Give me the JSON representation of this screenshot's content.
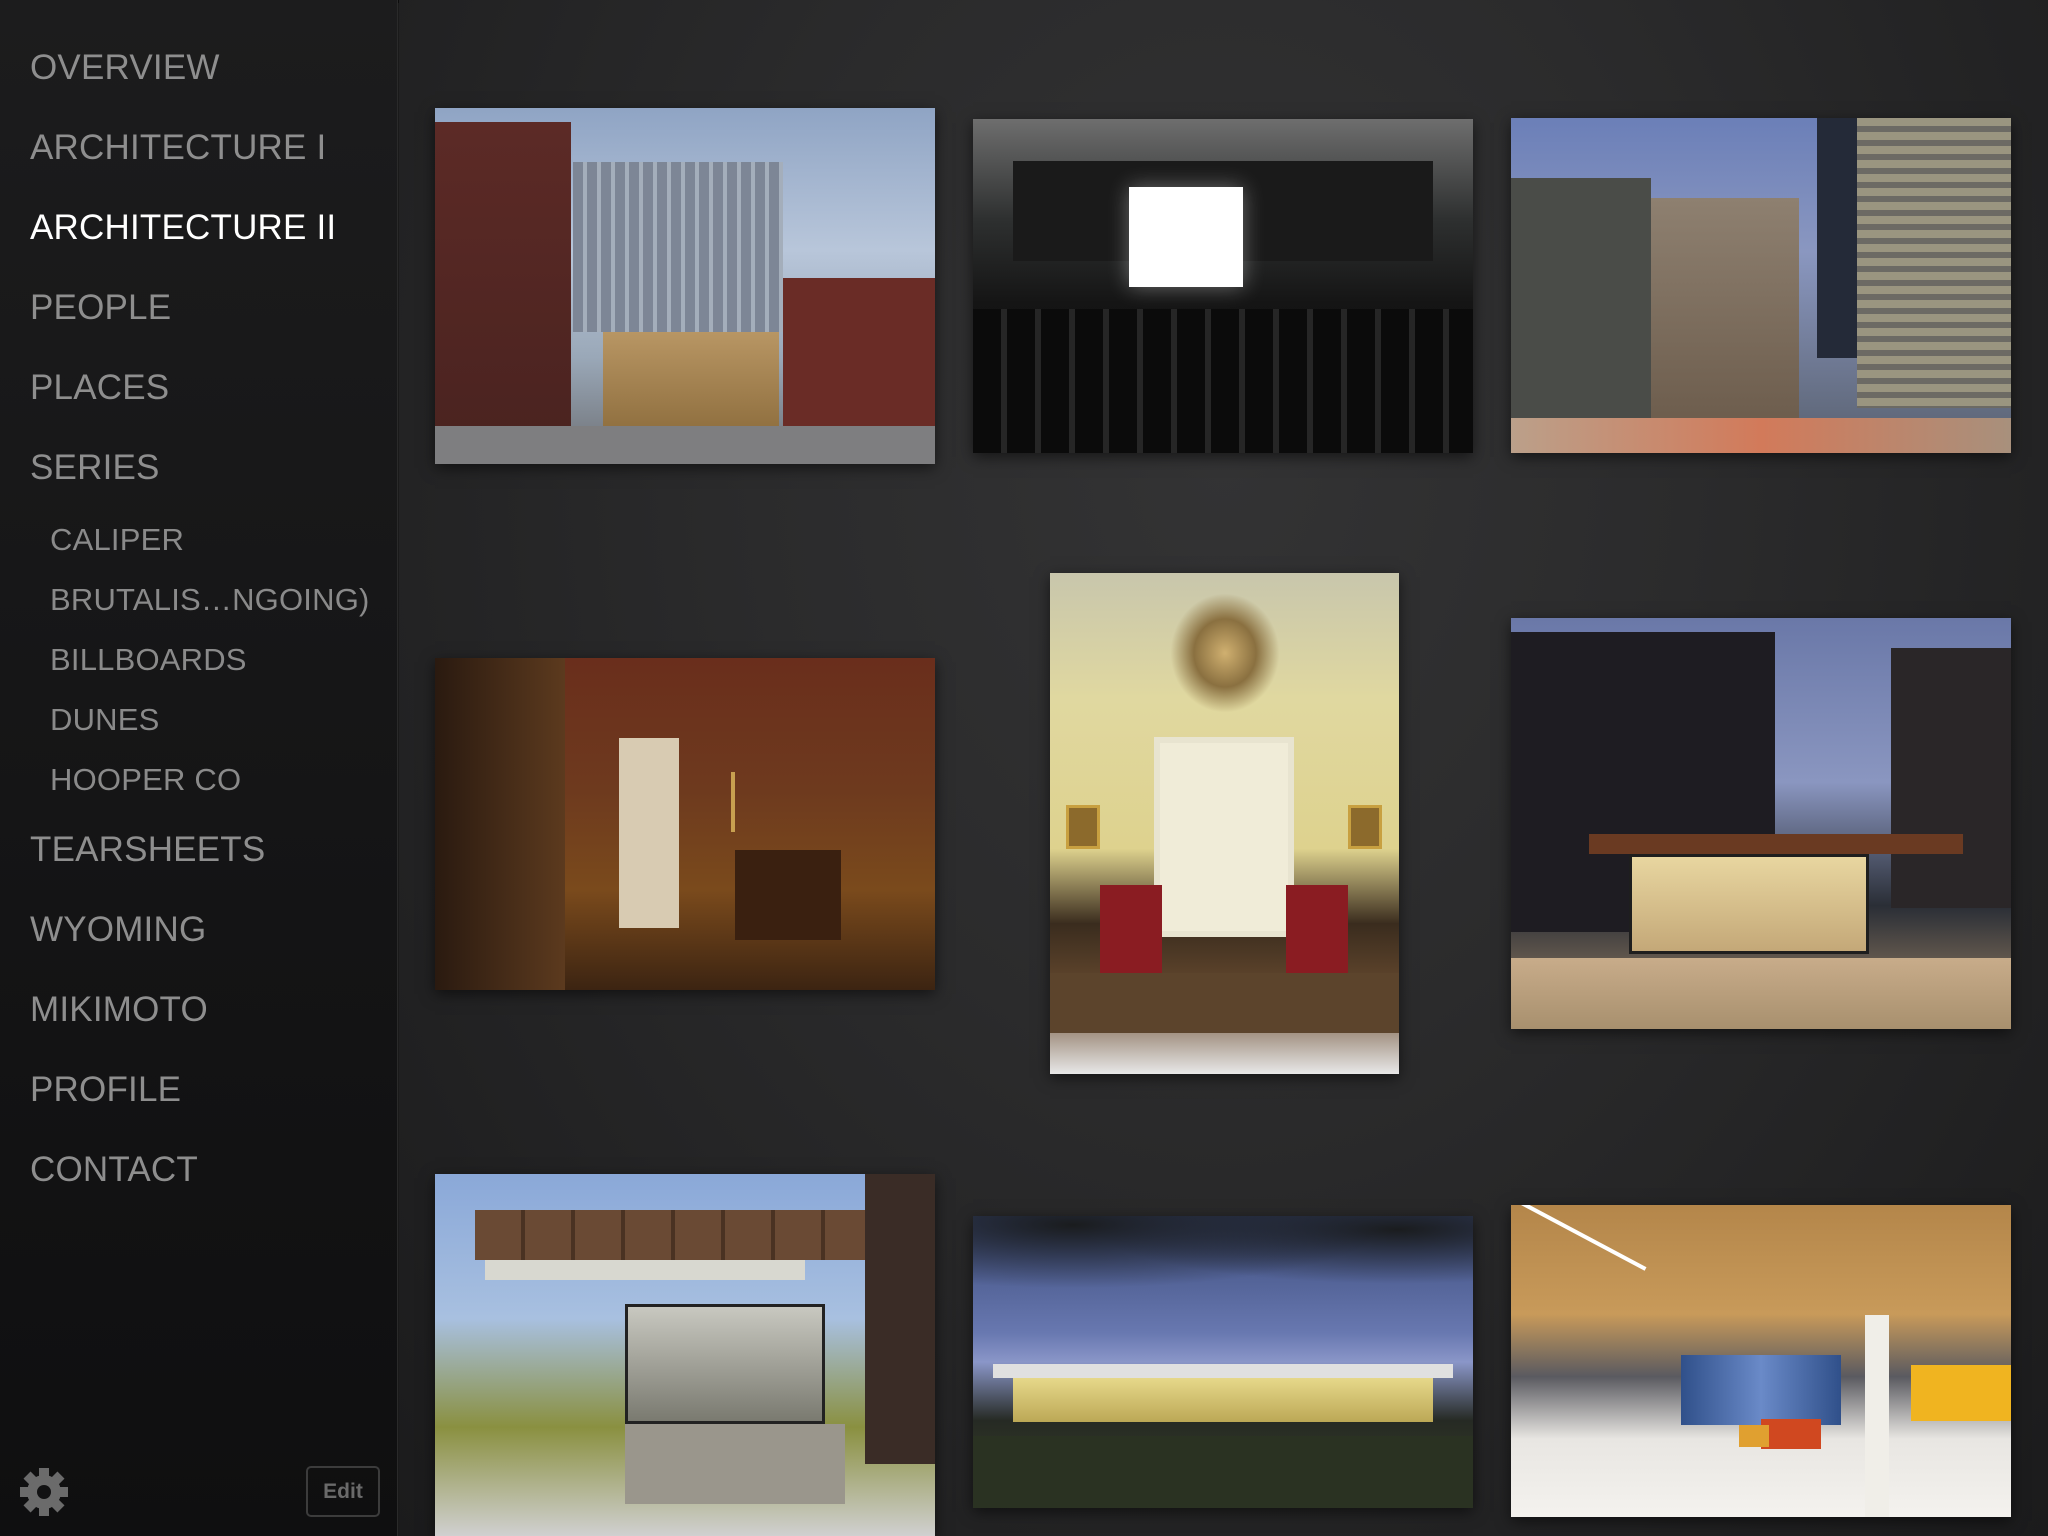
{
  "sidebar": {
    "items": [
      {
        "label": "OVERVIEW",
        "active": false
      },
      {
        "label": "ARCHITECTURE I",
        "active": false
      },
      {
        "label": "ARCHITECTURE II",
        "active": true
      },
      {
        "label": "PEOPLE",
        "active": false
      },
      {
        "label": "PLACES",
        "active": false
      },
      {
        "label": "SERIES",
        "active": false
      }
    ],
    "series_items": [
      {
        "label": "CALIPER"
      },
      {
        "label": "BRUTALIS…NGOING)"
      },
      {
        "label": "BILLBOARDS"
      },
      {
        "label": "DUNES"
      },
      {
        "label": "HOOPER CO"
      }
    ],
    "items_after": [
      {
        "label": "TEARSHEETS"
      },
      {
        "label": "WYOMING"
      },
      {
        "label": "MIKIMOTO"
      },
      {
        "label": "PROFILE"
      },
      {
        "label": "CONTACT"
      }
    ],
    "settings_icon": "gear-icon",
    "edit_label": "Edit"
  },
  "gallery": {
    "selected_section": "ARCHITECTURE II",
    "photos": [
      {
        "subject": "brick street facade with perforated metal building"
      },
      {
        "subject": "dark screening room with white screen"
      },
      {
        "subject": "gothic revival building at dusk"
      },
      {
        "subject": "wood-paneled hallway with crucifix"
      },
      {
        "subject": "yellow dining room with chandelier"
      },
      {
        "subject": "glass guard booth at dusk"
      },
      {
        "subject": "modern canopy entrance with copper fascia"
      },
      {
        "subject": "low pavilion building under trees at dusk"
      },
      {
        "subject": "bright office lobby with wood ceiling"
      }
    ]
  },
  "colors": {
    "sidebar_bg": "#161617",
    "main_bg": "#2d2d2e",
    "nav_text": "#8e8e8e",
    "nav_active": "#ffffff"
  }
}
